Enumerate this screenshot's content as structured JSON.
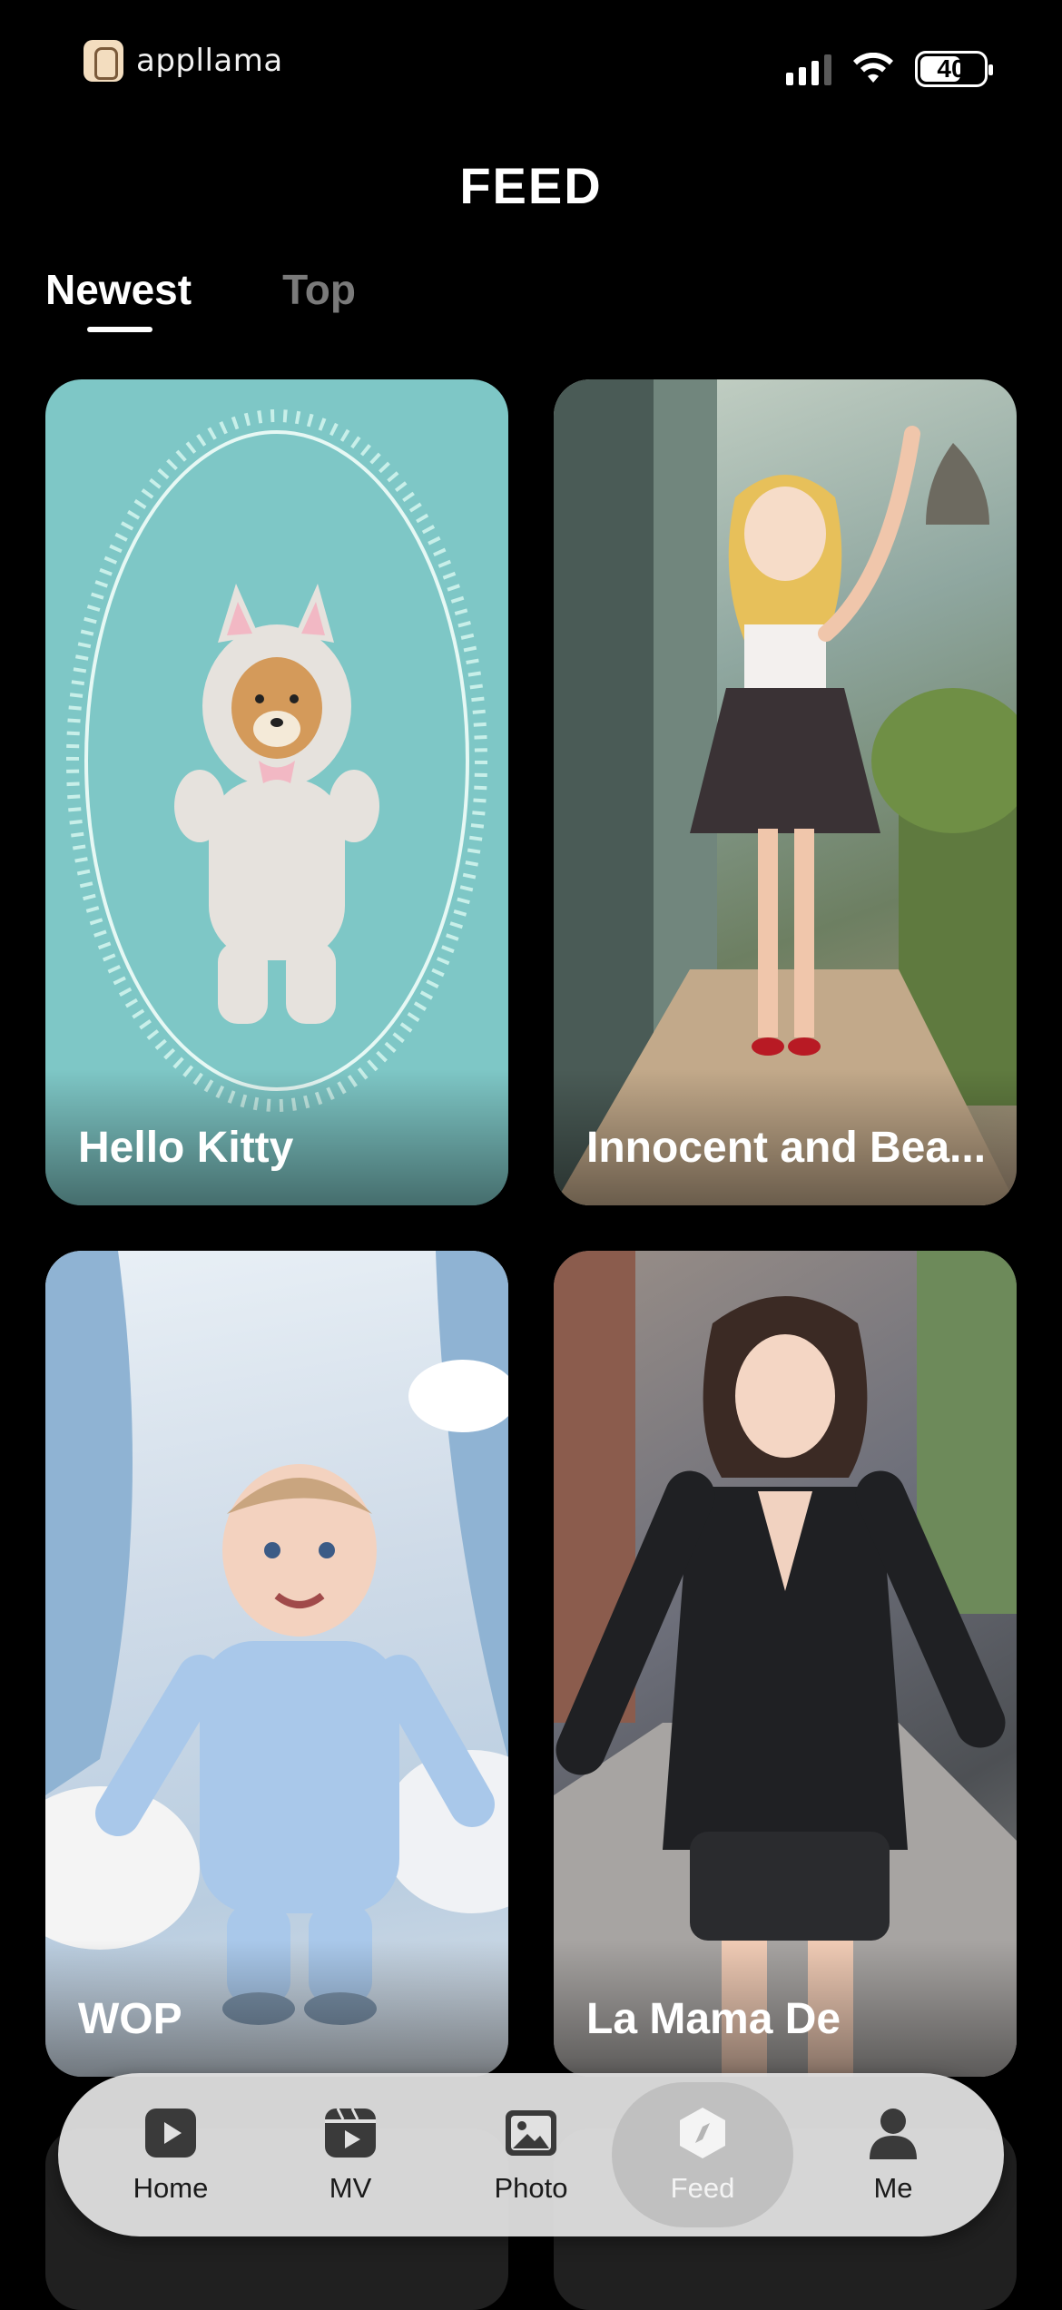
{
  "status_bar": {
    "brand": "appllama",
    "battery": "40"
  },
  "header": {
    "title": "FEED"
  },
  "tabs": [
    {
      "label": "Newest",
      "active": true
    },
    {
      "label": "Top",
      "active": false
    }
  ],
  "feed": [
    {
      "title": "Hello Kitty"
    },
    {
      "title": "Innocent and Bea..."
    },
    {
      "title": "WOP"
    },
    {
      "title": "La Mama De"
    }
  ],
  "nav": [
    {
      "label": "Home",
      "icon": "play-square-icon",
      "active": false
    },
    {
      "label": "MV",
      "icon": "clapper-icon",
      "active": false
    },
    {
      "label": "Photo",
      "icon": "image-icon",
      "active": false
    },
    {
      "label": "Feed",
      "icon": "compass-icon",
      "active": true
    },
    {
      "label": "Me",
      "icon": "person-icon",
      "active": false
    }
  ],
  "colors": {
    "background": "#000000",
    "nav_bg": "#e1e1e1",
    "tab_inactive": "#7a7a7a"
  }
}
